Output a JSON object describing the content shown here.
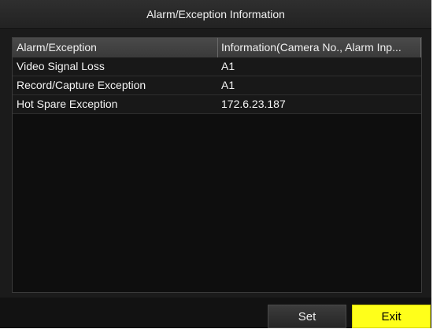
{
  "window": {
    "title": "Alarm/Exception Information"
  },
  "table": {
    "columns": [
      "Alarm/Exception",
      "Information(Camera No., Alarm Inp..."
    ],
    "rows": [
      {
        "type": "Video Signal Loss",
        "info": "A1"
      },
      {
        "type": "Record/Capture Exception",
        "info": "A1"
      },
      {
        "type": "Hot Spare Exception",
        "info": "172.6.23.187"
      }
    ]
  },
  "buttons": {
    "set_label": "Set",
    "exit_label": "Exit"
  },
  "colors": {
    "accent": "#ffff1a",
    "background": "#1b1b1b"
  }
}
